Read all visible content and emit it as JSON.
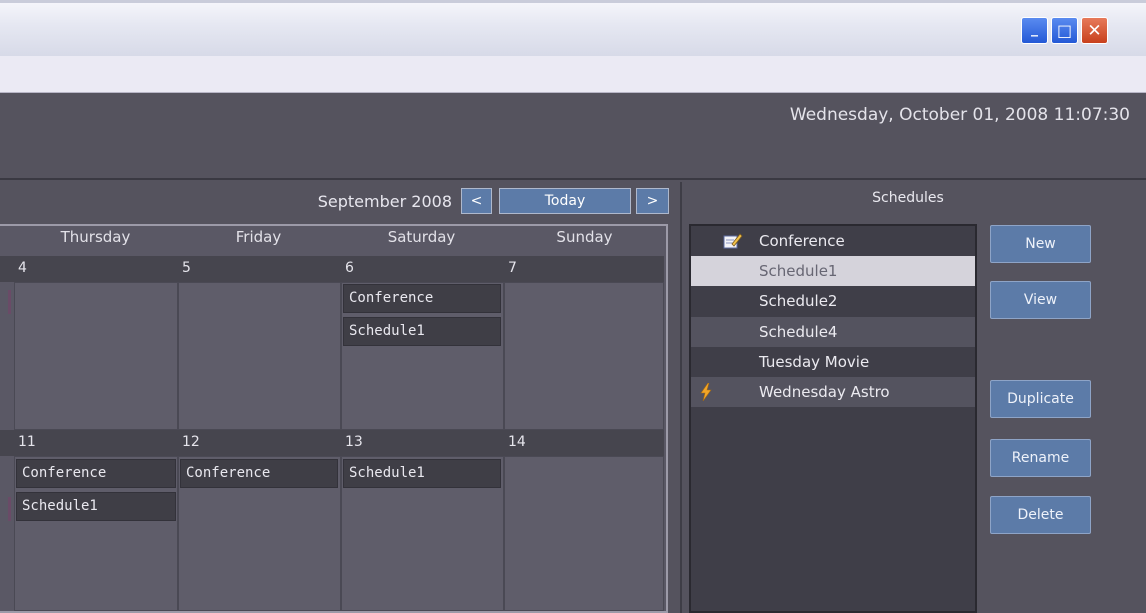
{
  "window": {
    "title": "",
    "controls": {
      "minimize": "_",
      "maximize": "□",
      "close": "✕"
    }
  },
  "header": {
    "datetime": "Wednesday, October 01, 2008 11:07:30"
  },
  "calendar": {
    "month_label": "September 2008",
    "prev_label": "<",
    "today_label": "Today",
    "next_label": ">",
    "day_names": [
      "Thursday",
      "Friday",
      "Saturday",
      "Sunday"
    ],
    "weeks": [
      {
        "days": [
          {
            "num": "4",
            "events": []
          },
          {
            "num": "5",
            "events": []
          },
          {
            "num": "6",
            "events": [
              "Conference",
              "Schedule1"
            ]
          },
          {
            "num": "7",
            "events": []
          }
        ]
      },
      {
        "days": [
          {
            "num": "11",
            "events": [
              "Conference",
              "Schedule1"
            ]
          },
          {
            "num": "12",
            "events": [
              "Conference"
            ]
          },
          {
            "num": "13",
            "events": [
              "Schedule1"
            ]
          },
          {
            "num": "14",
            "events": []
          }
        ]
      }
    ]
  },
  "schedules": {
    "title": "Schedules",
    "items": [
      {
        "label": "Conference",
        "icon": "edit-icon",
        "state": "normal"
      },
      {
        "label": "Schedule1",
        "icon": "",
        "state": "selected"
      },
      {
        "label": "Schedule2",
        "icon": "",
        "state": "normal"
      },
      {
        "label": "Schedule4",
        "icon": "",
        "state": "highlight"
      },
      {
        "label": "Tuesday Movie",
        "icon": "",
        "state": "normal"
      },
      {
        "label": "Wednesday Astro",
        "icon": "lightning-icon",
        "state": "highlight"
      }
    ],
    "buttons": {
      "new": "New",
      "view": "View",
      "duplicate": "Duplicate",
      "rename": "Rename",
      "delete": "Delete"
    }
  },
  "colors": {
    "background": "#55535e",
    "button": "#5c7ba8",
    "event": "#3f3e46",
    "selected": "#d5d3db"
  }
}
